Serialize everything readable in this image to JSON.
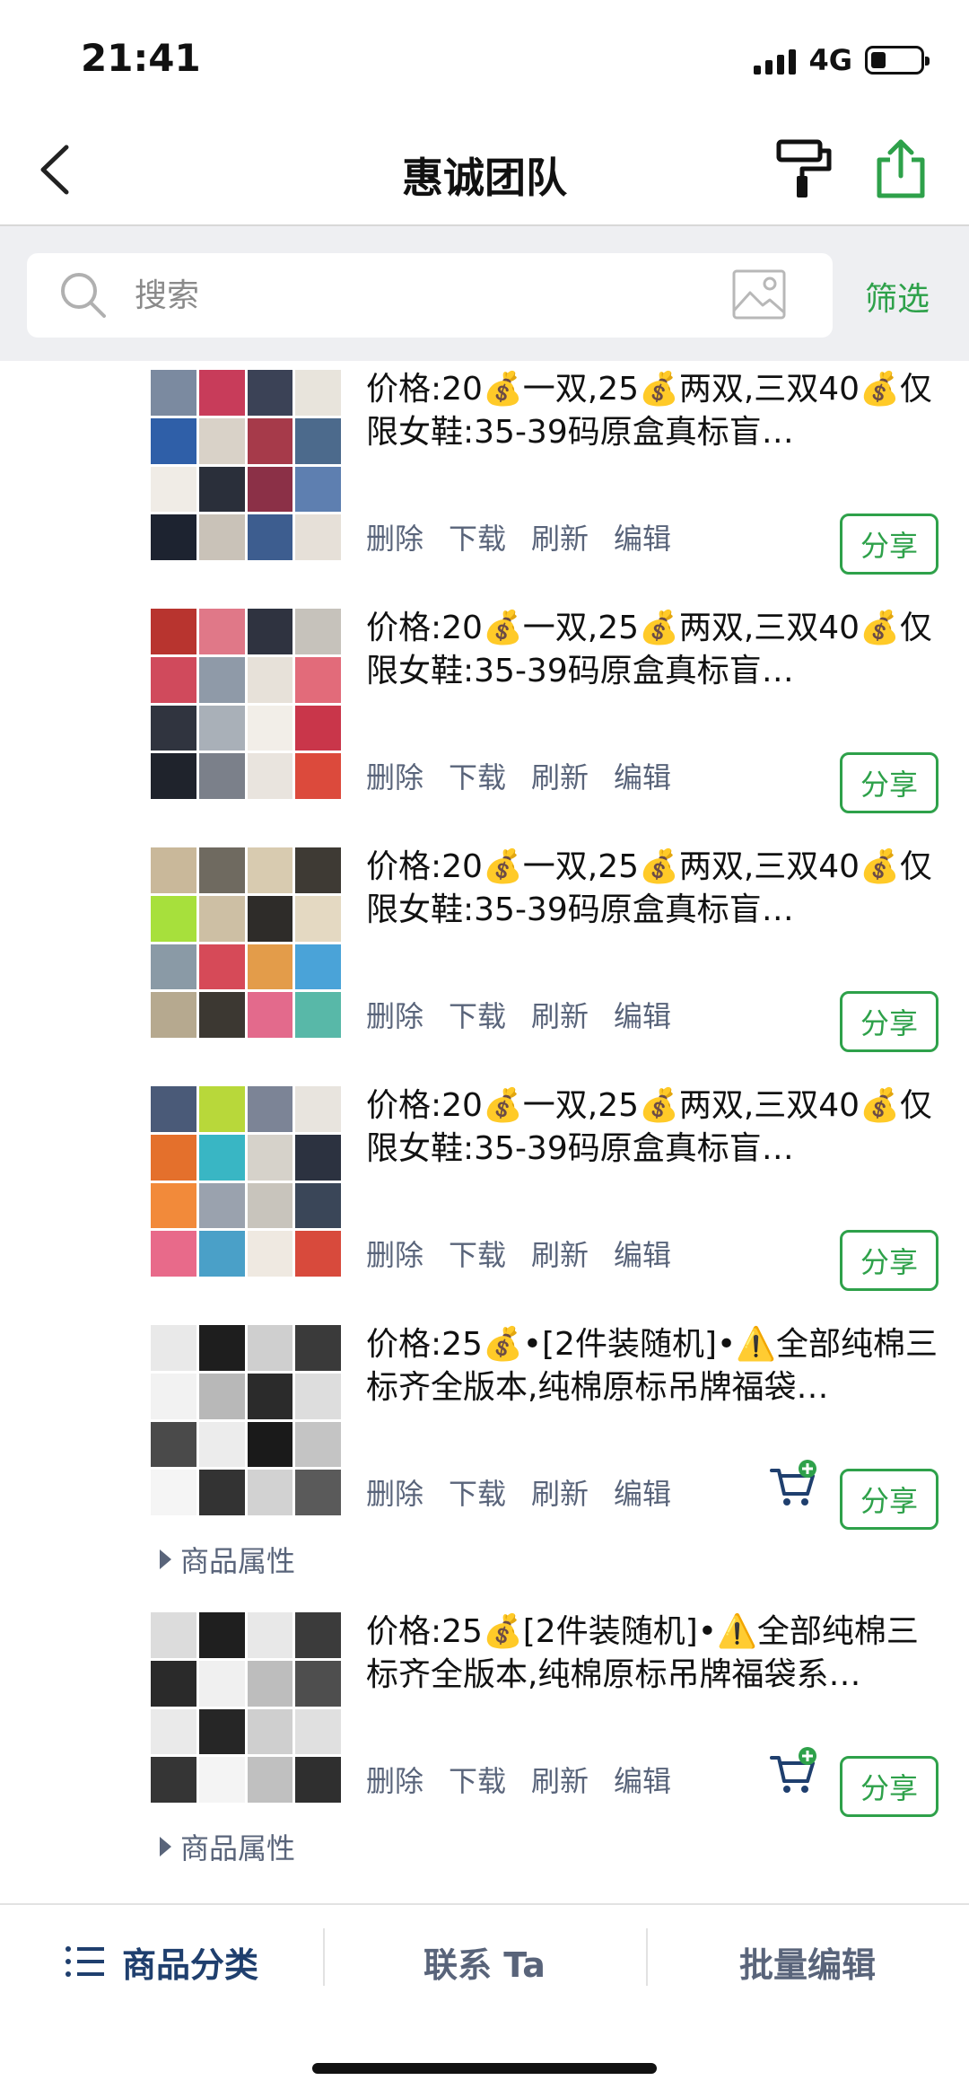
{
  "status": {
    "time": "21:41",
    "network": "4G"
  },
  "nav": {
    "title": "惠诚团队"
  },
  "search": {
    "placeholder": "搜索",
    "filter_label": "筛选"
  },
  "actions": {
    "delete": "删除",
    "download": "下载",
    "refresh": "刷新",
    "edit": "编辑",
    "share": "分享",
    "attributes": "商品属性"
  },
  "items": [
    {
      "desc": "价格:20💰一双,25💰两双,三双40💰仅限女鞋:35-39码原盒真标盲…",
      "cart": false,
      "attributes": false,
      "palette": [
        "#7b8aa0",
        "#c83c5a",
        "#3b4256",
        "#e8e4dc",
        "#2f5fa8",
        "#d9d2c8",
        "#a63a4a",
        "#4c6a8c",
        "#f0ece6",
        "#2a2f3a",
        "#8b3047",
        "#5e7fb0",
        "#1d2330",
        "#c9c2b8",
        "#3d5d8f",
        "#e6e0d8"
      ]
    },
    {
      "desc": "价格:20💰一双,25💰两双,三双40💰仅限女鞋:35-39码原盒真标盲…",
      "cart": false,
      "attributes": false,
      "palette": [
        "#b8342f",
        "#e07888",
        "#2f3340",
        "#c6c2bb",
        "#d04a5c",
        "#8f9aa8",
        "#e7e1d9",
        "#e26b7a",
        "#30343f",
        "#a9b0b8",
        "#f2eee8",
        "#c9364a",
        "#1f232c",
        "#7b808a",
        "#e9e4de",
        "#dc4a3c"
      ]
    },
    {
      "desc": "价格:20💰一双,25💰两双,三双40💰仅限女鞋:35-39码原盒真标盲…",
      "cart": false,
      "attributes": false,
      "palette": [
        "#c9b89a",
        "#6f6a60",
        "#d8cbb0",
        "#3e3a34",
        "#a7e03c",
        "#cdbfa4",
        "#2e2c29",
        "#e4d9c2",
        "#8a9aa6",
        "#d64a58",
        "#e39c4a",
        "#4aa3d8",
        "#b6a98f",
        "#3c3832",
        "#e36a8c",
        "#58b8a8"
      ]
    },
    {
      "desc": "价格:20💰一双,25💰两双,三双40💰仅限女鞋:35-39码原盒真标盲…",
      "cart": false,
      "attributes": false,
      "palette": [
        "#4a5a78",
        "#b8d83a",
        "#7c8496",
        "#e8e4de",
        "#e4702c",
        "#39b6c4",
        "#d6d2ca",
        "#2c3240",
        "#f28a3a",
        "#9aa2ae",
        "#c8c4bc",
        "#3a4658",
        "#e86a8a",
        "#4aa0c8",
        "#efe9e1",
        "#d84a3c"
      ]
    },
    {
      "desc": "价格:25💰•[2件装随机]•⚠️全部纯棉三标齐全版本,纯棉原标吊牌福袋…",
      "cart": true,
      "attributes": true,
      "palette": [
        "#e9e9e9",
        "#1e1e1e",
        "#cfcfcf",
        "#3a3a3a",
        "#f2f2f2",
        "#b8b8b8",
        "#2b2b2b",
        "#dddddd",
        "#4a4a4a",
        "#ececec",
        "#1a1a1a",
        "#c4c4c4",
        "#f5f5f5",
        "#333333",
        "#d2d2d2",
        "#5a5a5a"
      ]
    },
    {
      "desc": "价格:25💰[2件装随机]•⚠️全部纯棉三标齐全版本,纯棉原标吊牌福袋系…",
      "cart": true,
      "attributes": true,
      "palette": [
        "#dcdcdc",
        "#1f1f1f",
        "#e8e8e8",
        "#3b3b3b",
        "#2a2a2a",
        "#f0f0f0",
        "#bdbdbd",
        "#4e4e4e",
        "#eaeaea",
        "#262626",
        "#cfcfcf",
        "#e0e0e0",
        "#353535",
        "#f4f4f4",
        "#c0c0c0",
        "#2f2f2f"
      ]
    }
  ],
  "tabs": [
    {
      "label": "商品分类",
      "icon": "list-icon",
      "active": true
    },
    {
      "label": "联系 Ta",
      "active": false
    },
    {
      "label": "批量编辑",
      "active": false
    }
  ],
  "colors": {
    "accent": "#2ea14a",
    "link": "#59647a",
    "navy": "#1f3f6e"
  }
}
